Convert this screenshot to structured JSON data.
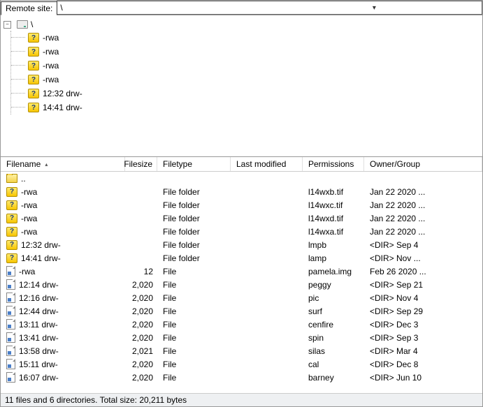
{
  "path_bar": {
    "label": "Remote site:",
    "value": "\\"
  },
  "tree": {
    "root": "\\",
    "children": [
      {
        "label": "-rwa"
      },
      {
        "label": "-rwa"
      },
      {
        "label": "-rwa"
      },
      {
        "label": "-rwa"
      },
      {
        "label": "12:32 drw-"
      },
      {
        "label": "14:41 drw-"
      }
    ]
  },
  "columns": {
    "name": "Filename",
    "size": "Filesize",
    "type": "Filetype",
    "mod": "Last modified",
    "perm": "Permissions",
    "own": "Owner/Group"
  },
  "rows": [
    {
      "icon": "folder",
      "name": "..",
      "size": "",
      "type": "",
      "mod": "",
      "perm": "",
      "own": ""
    },
    {
      "icon": "qfolder",
      "name": "-rwa",
      "size": "",
      "type": "File folder",
      "mod": "",
      "perm": "l14wxb.tif",
      "own": "Jan 22 2020 ..."
    },
    {
      "icon": "qfolder",
      "name": "-rwa",
      "size": "",
      "type": "File folder",
      "mod": "",
      "perm": "l14wxc.tif",
      "own": "Jan 22 2020 ..."
    },
    {
      "icon": "qfolder",
      "name": "-rwa",
      "size": "",
      "type": "File folder",
      "mod": "",
      "perm": "l14wxd.tif",
      "own": "Jan 22 2020 ..."
    },
    {
      "icon": "qfolder",
      "name": "-rwa",
      "size": "",
      "type": "File folder",
      "mod": "",
      "perm": "l14wxa.tif",
      "own": "Jan 22 2020 ..."
    },
    {
      "icon": "qfolder",
      "name": "12:32 drw-",
      "size": "",
      "type": "File folder",
      "mod": "",
      "perm": "lmpb",
      "own": "<DIR> Sep 4"
    },
    {
      "icon": "qfolder",
      "name": "14:41 drw-",
      "size": "",
      "type": "File folder",
      "mod": "",
      "perm": "lamp",
      "own": "<DIR> Nov ..."
    },
    {
      "icon": "file",
      "name": "-rwa",
      "size": "12",
      "type": "File",
      "mod": "",
      "perm": "pamela.img",
      "own": "Feb 26 2020 ..."
    },
    {
      "icon": "file",
      "name": "12:14 drw-",
      "size": "2,020",
      "type": "File",
      "mod": "",
      "perm": "peggy",
      "own": "<DIR> Sep 21"
    },
    {
      "icon": "file",
      "name": "12:16 drw-",
      "size": "2,020",
      "type": "File",
      "mod": "",
      "perm": "pic",
      "own": "<DIR> Nov 4"
    },
    {
      "icon": "file",
      "name": "12:44 drw-",
      "size": "2,020",
      "type": "File",
      "mod": "",
      "perm": "surf",
      "own": "<DIR> Sep 29"
    },
    {
      "icon": "file",
      "name": "13:11 drw-",
      "size": "2,020",
      "type": "File",
      "mod": "",
      "perm": "cenfire",
      "own": "<DIR> Dec 3"
    },
    {
      "icon": "file",
      "name": "13:41 drw-",
      "size": "2,020",
      "type": "File",
      "mod": "",
      "perm": "spin",
      "own": "<DIR> Sep 3"
    },
    {
      "icon": "file",
      "name": "13:58 drw-",
      "size": "2,021",
      "type": "File",
      "mod": "",
      "perm": "silas",
      "own": "<DIR> Mar 4"
    },
    {
      "icon": "file",
      "name": "15:11 drw-",
      "size": "2,020",
      "type": "File",
      "mod": "",
      "perm": "cal",
      "own": "<DIR> Dec 8"
    },
    {
      "icon": "file",
      "name": "16:07 drw-",
      "size": "2,020",
      "type": "File",
      "mod": "",
      "perm": "barney",
      "own": "<DIR> Jun 10"
    }
  ],
  "status": "11 files and 6 directories. Total size: 20,211 bytes"
}
